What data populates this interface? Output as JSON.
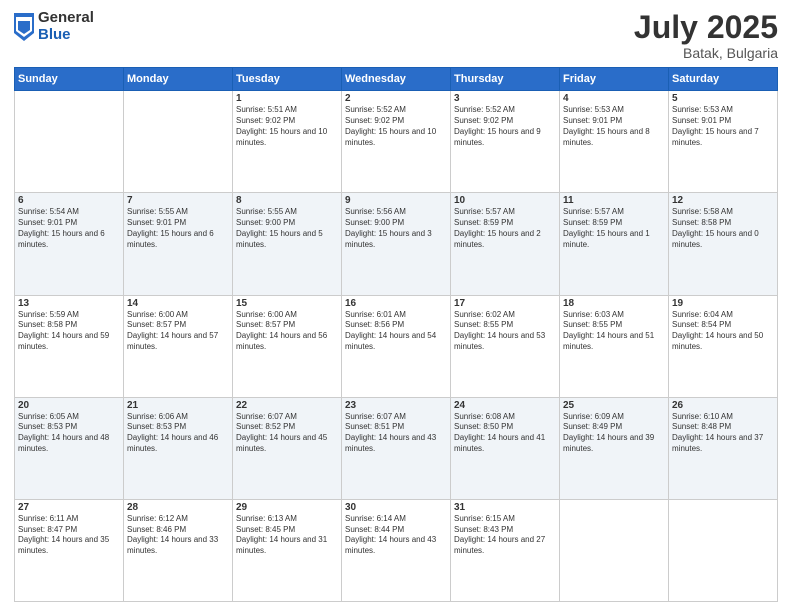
{
  "header": {
    "logo_general": "General",
    "logo_blue": "Blue",
    "title": "July 2025",
    "location": "Batak, Bulgaria"
  },
  "weekdays": [
    "Sunday",
    "Monday",
    "Tuesday",
    "Wednesday",
    "Thursday",
    "Friday",
    "Saturday"
  ],
  "weeks": [
    [
      {
        "day": "",
        "info": ""
      },
      {
        "day": "",
        "info": ""
      },
      {
        "day": "1",
        "info": "Sunrise: 5:51 AM\nSunset: 9:02 PM\nDaylight: 15 hours and 10 minutes."
      },
      {
        "day": "2",
        "info": "Sunrise: 5:52 AM\nSunset: 9:02 PM\nDaylight: 15 hours and 10 minutes."
      },
      {
        "day": "3",
        "info": "Sunrise: 5:52 AM\nSunset: 9:02 PM\nDaylight: 15 hours and 9 minutes."
      },
      {
        "day": "4",
        "info": "Sunrise: 5:53 AM\nSunset: 9:01 PM\nDaylight: 15 hours and 8 minutes."
      },
      {
        "day": "5",
        "info": "Sunrise: 5:53 AM\nSunset: 9:01 PM\nDaylight: 15 hours and 7 minutes."
      }
    ],
    [
      {
        "day": "6",
        "info": "Sunrise: 5:54 AM\nSunset: 9:01 PM\nDaylight: 15 hours and 6 minutes."
      },
      {
        "day": "7",
        "info": "Sunrise: 5:55 AM\nSunset: 9:01 PM\nDaylight: 15 hours and 6 minutes."
      },
      {
        "day": "8",
        "info": "Sunrise: 5:55 AM\nSunset: 9:00 PM\nDaylight: 15 hours and 5 minutes."
      },
      {
        "day": "9",
        "info": "Sunrise: 5:56 AM\nSunset: 9:00 PM\nDaylight: 15 hours and 3 minutes."
      },
      {
        "day": "10",
        "info": "Sunrise: 5:57 AM\nSunset: 8:59 PM\nDaylight: 15 hours and 2 minutes."
      },
      {
        "day": "11",
        "info": "Sunrise: 5:57 AM\nSunset: 8:59 PM\nDaylight: 15 hours and 1 minute."
      },
      {
        "day": "12",
        "info": "Sunrise: 5:58 AM\nSunset: 8:58 PM\nDaylight: 15 hours and 0 minutes."
      }
    ],
    [
      {
        "day": "13",
        "info": "Sunrise: 5:59 AM\nSunset: 8:58 PM\nDaylight: 14 hours and 59 minutes."
      },
      {
        "day": "14",
        "info": "Sunrise: 6:00 AM\nSunset: 8:57 PM\nDaylight: 14 hours and 57 minutes."
      },
      {
        "day": "15",
        "info": "Sunrise: 6:00 AM\nSunset: 8:57 PM\nDaylight: 14 hours and 56 minutes."
      },
      {
        "day": "16",
        "info": "Sunrise: 6:01 AM\nSunset: 8:56 PM\nDaylight: 14 hours and 54 minutes."
      },
      {
        "day": "17",
        "info": "Sunrise: 6:02 AM\nSunset: 8:55 PM\nDaylight: 14 hours and 53 minutes."
      },
      {
        "day": "18",
        "info": "Sunrise: 6:03 AM\nSunset: 8:55 PM\nDaylight: 14 hours and 51 minutes."
      },
      {
        "day": "19",
        "info": "Sunrise: 6:04 AM\nSunset: 8:54 PM\nDaylight: 14 hours and 50 minutes."
      }
    ],
    [
      {
        "day": "20",
        "info": "Sunrise: 6:05 AM\nSunset: 8:53 PM\nDaylight: 14 hours and 48 minutes."
      },
      {
        "day": "21",
        "info": "Sunrise: 6:06 AM\nSunset: 8:53 PM\nDaylight: 14 hours and 46 minutes."
      },
      {
        "day": "22",
        "info": "Sunrise: 6:07 AM\nSunset: 8:52 PM\nDaylight: 14 hours and 45 minutes."
      },
      {
        "day": "23",
        "info": "Sunrise: 6:07 AM\nSunset: 8:51 PM\nDaylight: 14 hours and 43 minutes."
      },
      {
        "day": "24",
        "info": "Sunrise: 6:08 AM\nSunset: 8:50 PM\nDaylight: 14 hours and 41 minutes."
      },
      {
        "day": "25",
        "info": "Sunrise: 6:09 AM\nSunset: 8:49 PM\nDaylight: 14 hours and 39 minutes."
      },
      {
        "day": "26",
        "info": "Sunrise: 6:10 AM\nSunset: 8:48 PM\nDaylight: 14 hours and 37 minutes."
      }
    ],
    [
      {
        "day": "27",
        "info": "Sunrise: 6:11 AM\nSunset: 8:47 PM\nDaylight: 14 hours and 35 minutes."
      },
      {
        "day": "28",
        "info": "Sunrise: 6:12 AM\nSunset: 8:46 PM\nDaylight: 14 hours and 33 minutes."
      },
      {
        "day": "29",
        "info": "Sunrise: 6:13 AM\nSunset: 8:45 PM\nDaylight: 14 hours and 31 minutes."
      },
      {
        "day": "30",
        "info": "Sunrise: 6:14 AM\nSunset: 8:44 PM\nDaylight: 14 hours and 43 minutes."
      },
      {
        "day": "31",
        "info": "Sunrise: 6:15 AM\nSunset: 8:43 PM\nDaylight: 14 hours and 27 minutes."
      },
      {
        "day": "",
        "info": ""
      },
      {
        "day": "",
        "info": ""
      }
    ]
  ]
}
